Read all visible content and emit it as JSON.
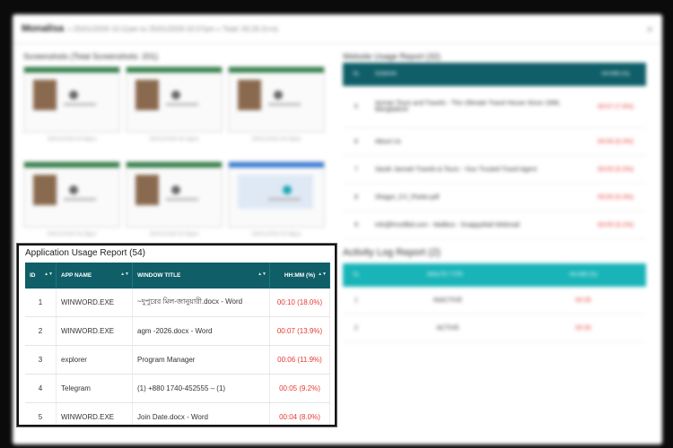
{
  "modal": {
    "name": "Monalisa",
    "meta": "» 25/01/2026 10:11am to 25/01/2026 02:07pm » Total: 00:26 (h:m)",
    "close_icon": "close-icon"
  },
  "screenshots": {
    "title": "Screenshots (Total Screenshots: 201)",
    "captions": [
      "25/01/2026 03:08pm",
      "25/01/2026 03:18pm",
      "25/01/2026 03:28pm",
      "25/01/2026 03:28pm",
      "25/01/2026 03:38pm",
      "25/01/2026 03:38pm"
    ]
  },
  "website_report": {
    "title": "Website Usage Report (32)",
    "headers": [
      "SL",
      "DOMAIN",
      "HH:MM (%)"
    ],
    "rows": [
      {
        "id": "5",
        "domain": "Ayman Tours and Travels - The Ultimate Travel House Since 1996, Bangladesh",
        "time": "00:07 (7.6%)"
      },
      {
        "id": "6",
        "domain": "About Us",
        "time": "00:06 (6.3%)"
      },
      {
        "id": "7",
        "domain": "Sarah Jannah Travels & Tours - Your Trusted Travel Agent",
        "time": "00:05 (5.3%)"
      },
      {
        "id": "8",
        "domain": "Shagor_CV_Flutter.pdf",
        "time": "00:05 (5.3%)"
      },
      {
        "id": "9",
        "domain": "info@hrsoftbd.com - Mailbox - SnappyMail Webmail",
        "time": "00:05 (5.2%)"
      }
    ]
  },
  "activity_log": {
    "title": "Activity Log Report (2)",
    "headers": [
      "SL",
      "MINUTE TYPE",
      "HH:MM (%)"
    ],
    "rows": [
      {
        "id": "1",
        "type": "INACTIVE",
        "time": "00:35"
      },
      {
        "id": "2",
        "type": "ACTIVE",
        "time": "00:35"
      }
    ]
  },
  "app_usage": {
    "title": "Application Usage Report (54)",
    "headers": {
      "id": "ID",
      "app": "APP NAME",
      "window": "WINDOW TITLE",
      "time": "HH:MM (%)"
    },
    "rows": [
      {
        "id": "1",
        "app": "WINWORD.EXE",
        "window": "~দুপুরের মিল-জানুয়ারী.docx - Word",
        "time": "00:10 (18.0%)"
      },
      {
        "id": "2",
        "app": "WINWORD.EXE",
        "window": "agm -2026.docx - Word",
        "time": "00:07 (13.9%)"
      },
      {
        "id": "3",
        "app": "explorer",
        "window": "Program Manager",
        "time": "00:06 (11.9%)"
      },
      {
        "id": "4",
        "app": "Telegram",
        "window": "(1) +880 1740-452555 – (1)",
        "time": "00:05 (9.2%)"
      },
      {
        "id": "5",
        "app": "WINWORD.EXE",
        "window": "Join Date.docx - Word",
        "time": "00:04 (8.0%)"
      }
    ]
  }
}
